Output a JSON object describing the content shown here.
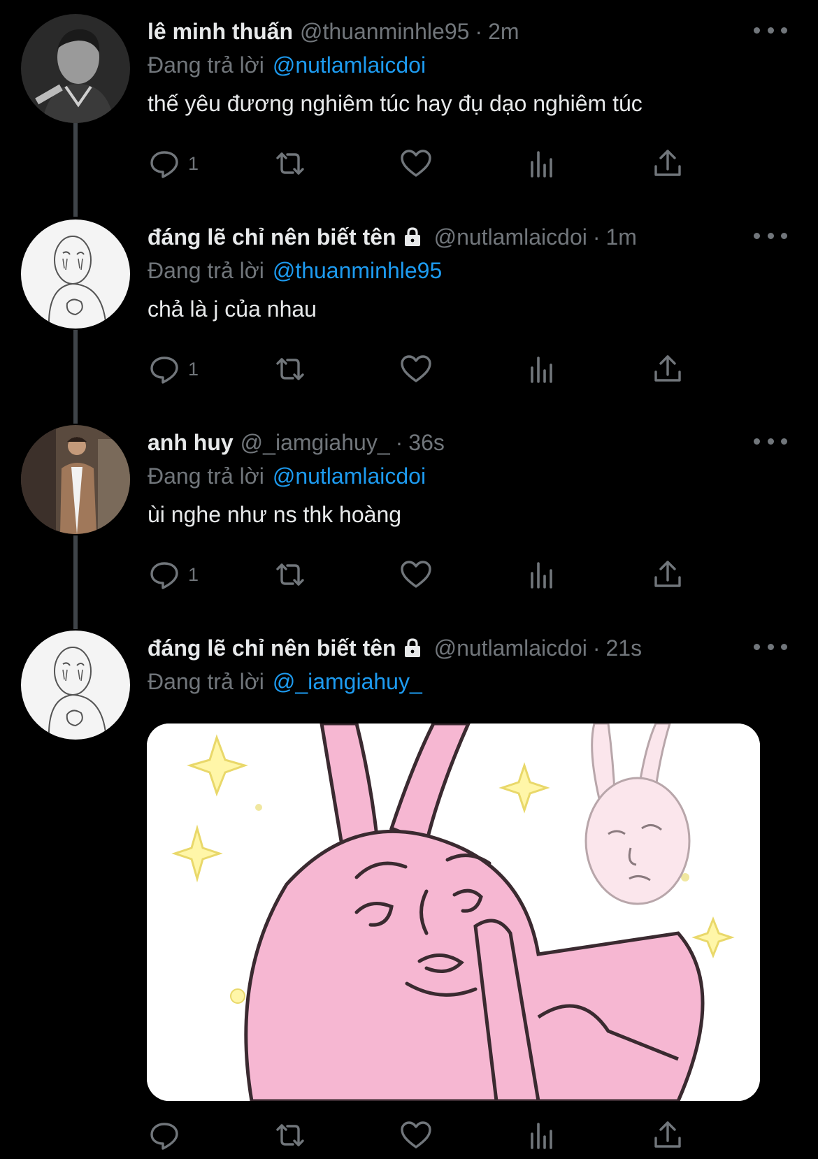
{
  "reply_prefix": "Đang trả lời",
  "tweets": [
    {
      "name": "lê minh thuấn",
      "handle": "@thuanminhle95",
      "time": "2m",
      "reply_to": "@nutlamlaicdoi",
      "text": "thế yêu đương nghiêm túc hay đụ dạo nghiêm túc",
      "reply_count": "1",
      "avatar": "man-portrait-bw"
    },
    {
      "name": "đáng lẽ chỉ nên biết tên",
      "handle": "@nutlamlaicdoi",
      "time": "1m",
      "reply_to": "@thuanminhle95",
      "text": "chả là j của nhau",
      "reply_count": "1",
      "avatar": "sketch-character"
    },
    {
      "name": "anh huy",
      "handle": "@_iamgiahuy_",
      "time": "36s",
      "reply_to": "@nutlamlaicdoi",
      "text": "ùi nghe như ns thk hoàng",
      "reply_count": "1",
      "avatar": "man-in-suit"
    },
    {
      "name": "đáng lẽ chỉ nên biết tên",
      "handle": "@nutlamlaicdoi",
      "time": "21s",
      "reply_to": "@_iamgiahuy_",
      "text": "",
      "reply_count": "",
      "avatar": "sketch-character",
      "media": "pink-rabbit-meme"
    }
  ],
  "colors": {
    "background": "#000000",
    "text": "#e7e9ea",
    "muted": "#71767b",
    "accent": "#1d9bf0",
    "thread_line": "#3f4449"
  }
}
